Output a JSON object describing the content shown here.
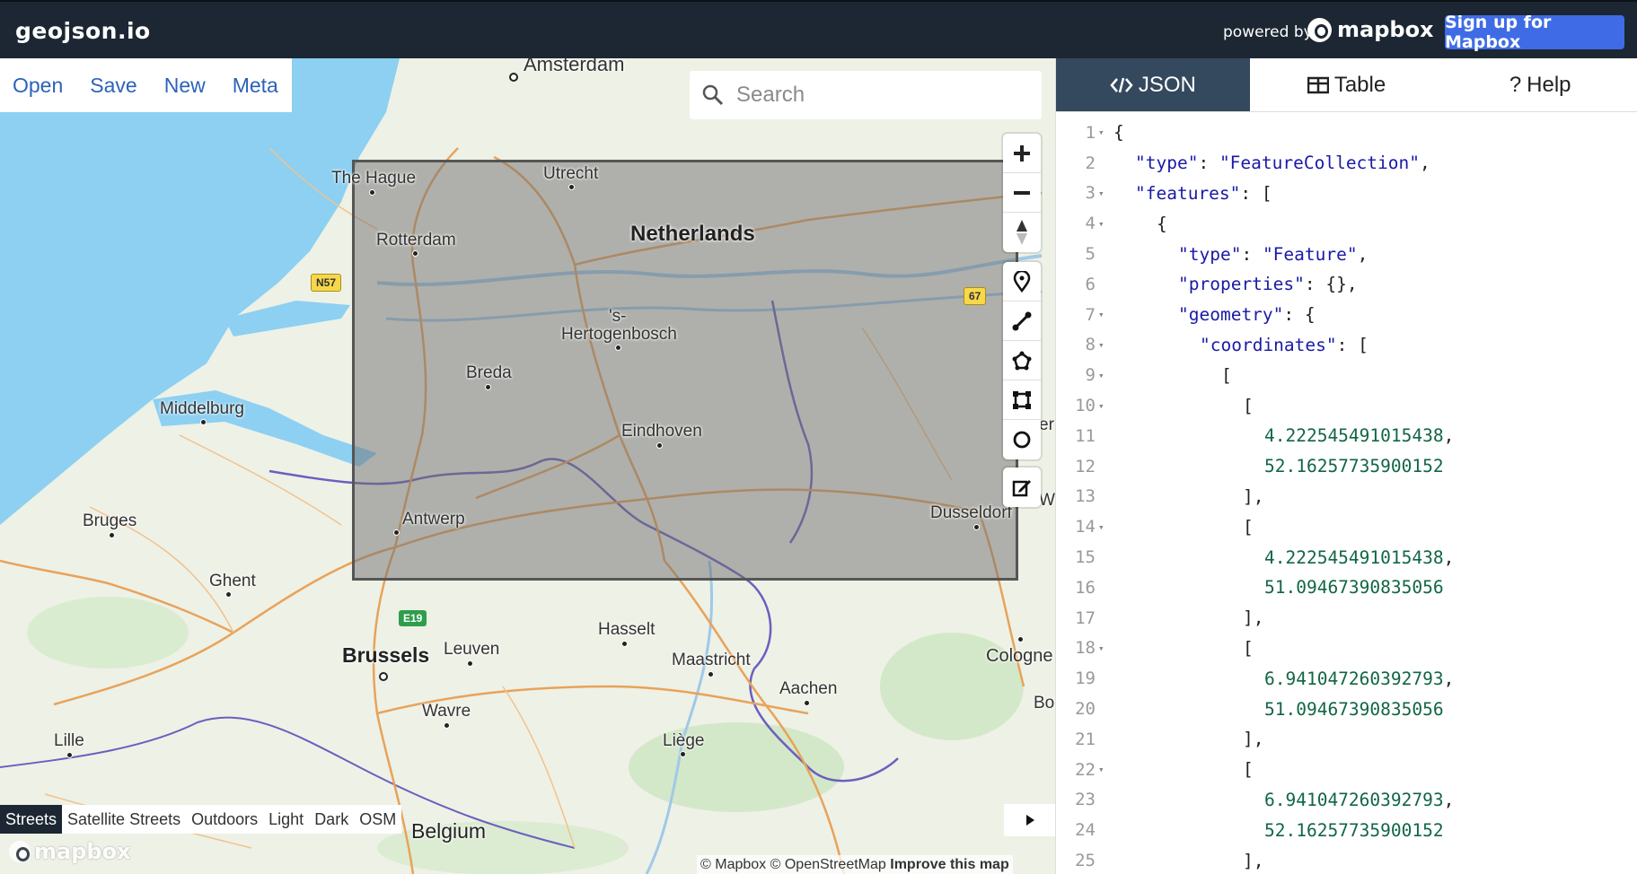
{
  "app": {
    "brand": "geojson.io",
    "powered_by": "powered by",
    "mapbox_label": "mapbox",
    "signup_label": "Sign up for Mapbox"
  },
  "menu": {
    "open": "Open",
    "save": "Save",
    "new": "New",
    "meta": "Meta"
  },
  "search": {
    "placeholder": "Search"
  },
  "map": {
    "labels": {
      "amsterdam": "Amsterdam",
      "the_hague": "The Hague",
      "utrecht": "Utrecht",
      "netherlands": "Netherlands",
      "rotterdam": "Rotterdam",
      "s": "'s-",
      "hertogenbosch": "Hertogenbosch",
      "breda": "Breda",
      "middelburg": "Middelburg",
      "eindhoven": "Eindhoven",
      "bruges": "Bruges",
      "antwerp": "Antwerp",
      "dusseldorf": "Dusseldorf",
      "ghent": "Ghent",
      "hasselt": "Hasselt",
      "brussels": "Brussels",
      "leuven": "Leuven",
      "maastricht": "Maastricht",
      "cologne": "Cologne",
      "aachen": "Aachen",
      "wavre": "Wavre",
      "lille": "Lille",
      "liege": "Liège",
      "belgium": "Belgium",
      "bo": "Bo",
      "er": "er",
      "wu": "Wu"
    },
    "shields": {
      "n57": "N57",
      "a67": "67",
      "e19": "E19"
    },
    "layers": [
      "Streets",
      "Satellite Streets",
      "Outdoors",
      "Light",
      "Dark",
      "OSM"
    ],
    "active_layer": "Streets",
    "attribution": {
      "mapbox": "© Mapbox",
      "osm": "© OpenStreetMap",
      "improve": "Improve this map"
    },
    "watermark": "mapbox",
    "colors": {
      "water": "#8dd0f2",
      "land": "#eef1e6",
      "road": "#e8a35a",
      "border": "#6b5fbf",
      "selection": "#707070"
    }
  },
  "panel": {
    "tabs": {
      "json": "JSON",
      "table": "Table",
      "help": "Help"
    },
    "active_tab": "JSON",
    "lines": [
      {
        "n": "1",
        "f": "▾",
        "i": 0,
        "t": [
          {
            "c": "p",
            "v": "{"
          }
        ]
      },
      {
        "n": "2",
        "f": "",
        "i": 1,
        "t": [
          {
            "c": "k",
            "v": "\"type\""
          },
          {
            "c": "p",
            "v": ": "
          },
          {
            "c": "s",
            "v": "\"FeatureCollection\""
          },
          {
            "c": "p",
            "v": ","
          }
        ]
      },
      {
        "n": "3",
        "f": "▾",
        "i": 1,
        "t": [
          {
            "c": "k",
            "v": "\"features\""
          },
          {
            "c": "p",
            "v": ": ["
          }
        ]
      },
      {
        "n": "4",
        "f": "▾",
        "i": 2,
        "t": [
          {
            "c": "p",
            "v": "{"
          }
        ]
      },
      {
        "n": "5",
        "f": "",
        "i": 3,
        "t": [
          {
            "c": "k",
            "v": "\"type\""
          },
          {
            "c": "p",
            "v": ": "
          },
          {
            "c": "s",
            "v": "\"Feature\""
          },
          {
            "c": "p",
            "v": ","
          }
        ]
      },
      {
        "n": "6",
        "f": "",
        "i": 3,
        "t": [
          {
            "c": "k",
            "v": "\"properties\""
          },
          {
            "c": "p",
            "v": ": {},"
          }
        ]
      },
      {
        "n": "7",
        "f": "▾",
        "i": 3,
        "t": [
          {
            "c": "k",
            "v": "\"geometry\""
          },
          {
            "c": "p",
            "v": ": {"
          }
        ]
      },
      {
        "n": "8",
        "f": "▾",
        "i": 4,
        "t": [
          {
            "c": "k",
            "v": "\"coordinates\""
          },
          {
            "c": "p",
            "v": ": ["
          }
        ]
      },
      {
        "n": "9",
        "f": "▾",
        "i": 5,
        "t": [
          {
            "c": "p",
            "v": "["
          }
        ]
      },
      {
        "n": "10",
        "f": "▾",
        "i": 6,
        "t": [
          {
            "c": "p",
            "v": "["
          }
        ]
      },
      {
        "n": "11",
        "f": "",
        "i": 7,
        "t": [
          {
            "c": "n",
            "v": "4.222545491015438"
          },
          {
            "c": "p",
            "v": ","
          }
        ]
      },
      {
        "n": "12",
        "f": "",
        "i": 7,
        "t": [
          {
            "c": "n",
            "v": "52.16257735900152"
          }
        ]
      },
      {
        "n": "13",
        "f": "",
        "i": 6,
        "t": [
          {
            "c": "p",
            "v": "],"
          }
        ]
      },
      {
        "n": "14",
        "f": "▾",
        "i": 6,
        "t": [
          {
            "c": "p",
            "v": "["
          }
        ]
      },
      {
        "n": "15",
        "f": "",
        "i": 7,
        "t": [
          {
            "c": "n",
            "v": "4.222545491015438"
          },
          {
            "c": "p",
            "v": ","
          }
        ]
      },
      {
        "n": "16",
        "f": "",
        "i": 7,
        "t": [
          {
            "c": "n",
            "v": "51.09467390835056"
          }
        ]
      },
      {
        "n": "17",
        "f": "",
        "i": 6,
        "t": [
          {
            "c": "p",
            "v": "],"
          }
        ]
      },
      {
        "n": "18",
        "f": "▾",
        "i": 6,
        "t": [
          {
            "c": "p",
            "v": "["
          }
        ]
      },
      {
        "n": "19",
        "f": "",
        "i": 7,
        "t": [
          {
            "c": "n",
            "v": "6.941047260392793"
          },
          {
            "c": "p",
            "v": ","
          }
        ]
      },
      {
        "n": "20",
        "f": "",
        "i": 7,
        "t": [
          {
            "c": "n",
            "v": "51.09467390835056"
          }
        ]
      },
      {
        "n": "21",
        "f": "",
        "i": 6,
        "t": [
          {
            "c": "p",
            "v": "],"
          }
        ]
      },
      {
        "n": "22",
        "f": "▾",
        "i": 6,
        "t": [
          {
            "c": "p",
            "v": "["
          }
        ]
      },
      {
        "n": "23",
        "f": "",
        "i": 7,
        "t": [
          {
            "c": "n",
            "v": "6.941047260392793"
          },
          {
            "c": "p",
            "v": ","
          }
        ]
      },
      {
        "n": "24",
        "f": "",
        "i": 7,
        "t": [
          {
            "c": "n",
            "v": "52.16257735900152"
          }
        ]
      },
      {
        "n": "25",
        "f": "",
        "i": 6,
        "t": [
          {
            "c": "p",
            "v": "],"
          }
        ]
      }
    ]
  },
  "icons": [
    "search-icon",
    "zoom-in-icon",
    "zoom-out-icon",
    "compass-icon",
    "marker-icon",
    "line-icon",
    "polygon-icon",
    "rectangle-icon",
    "circle-icon",
    "edit-icon",
    "code-icon",
    "table-icon",
    "help-icon",
    "chevron-right-icon"
  ]
}
